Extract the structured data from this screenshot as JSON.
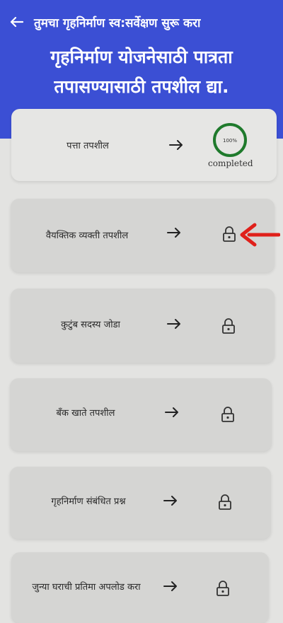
{
  "header": {
    "nav_title": "तुमचा गृहनिर्माण स्व:सर्वेक्षण सुरू करा",
    "title_line1": "गृहनिर्माण योजनेसाठी पात्रता",
    "title_line2": "तपासण्यासाठी तपशील द्या.",
    "background_color": "#3b4fd4"
  },
  "steps": [
    {
      "label": "पत्ता तपशील",
      "status": "completed",
      "progress_percent_text": "100%",
      "completed_text": "completed",
      "progress": 1.0
    },
    {
      "label": "वैयक्तिक व्यक्ती तपशील",
      "status": "locked",
      "icon": "lock-icon"
    },
    {
      "label": "कुटुंब सदस्य जोडा",
      "status": "locked",
      "icon": "lock-icon"
    },
    {
      "label": "बँक खाते तपशील",
      "status": "locked",
      "icon": "lock-icon"
    },
    {
      "label": "गृहनिर्माण संबंधित प्रश्न",
      "status": "locked",
      "icon": "lock-icon"
    },
    {
      "label": "जुन्या घराची प्रतिमा अपलोड करा",
      "status": "locked",
      "icon": "lock-icon"
    }
  ],
  "colors": {
    "progress_ring": "#1f7a2c",
    "annotation_arrow": "#e0201a"
  }
}
